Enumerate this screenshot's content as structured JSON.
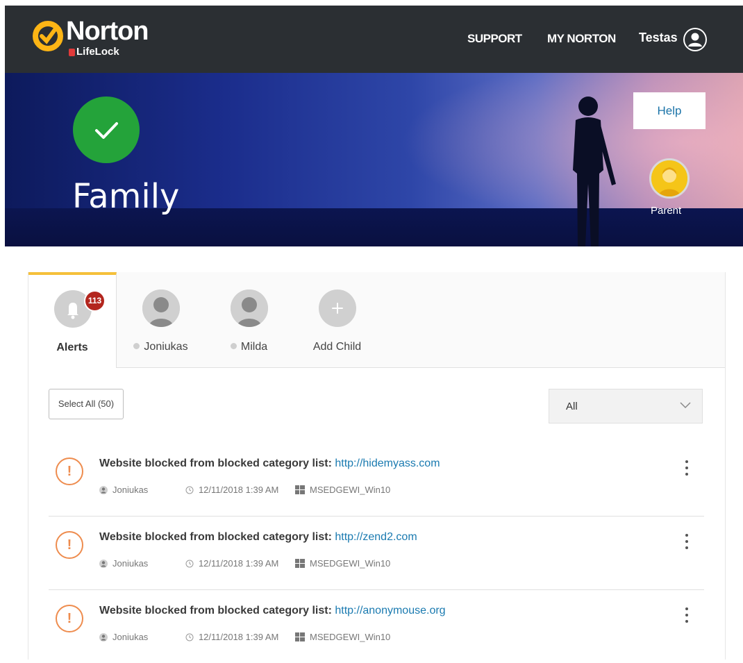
{
  "brand": {
    "name": "Norton",
    "sub_brand": "LifeLock"
  },
  "nav": {
    "support": "SUPPORT",
    "my_norton": "MY NORTON",
    "user_name": "Testas"
  },
  "hero": {
    "title": "Family",
    "status": "protected",
    "help_label": "Help",
    "parent_label": "Parent"
  },
  "tabs": [
    {
      "label": "Alerts",
      "badge": "113",
      "active": true
    },
    {
      "label": "Joniukas"
    },
    {
      "label": "Milda"
    },
    {
      "label": "Add Child"
    }
  ],
  "toolbar": {
    "select_all": "Select All (50)",
    "filter_value": "All"
  },
  "alerts": [
    {
      "message": "Website blocked from blocked category list:",
      "url": "http://hidemyass.com",
      "child": "Joniukas",
      "time": "12/11/2018 1:39 AM",
      "device": "MSEDGEWI_Win10"
    },
    {
      "message": "Website blocked from blocked category list:",
      "url": "http://zend2.com",
      "child": "Joniukas",
      "time": "12/11/2018 1:39 AM",
      "device": "MSEDGEWI_Win10"
    },
    {
      "message": "Website blocked from blocked category list:",
      "url": "http://anonymouse.org",
      "child": "Joniukas",
      "time": "12/11/2018 1:39 AM",
      "device": "MSEDGEWI_Win10"
    }
  ],
  "colors": {
    "topbar": "#2b2f33",
    "accent_yellow": "#f5c03a",
    "success_green": "#24a33a",
    "warning_orange": "#ee8c4e",
    "link_blue": "#1a7ab0",
    "badge_red": "#b3261e"
  }
}
